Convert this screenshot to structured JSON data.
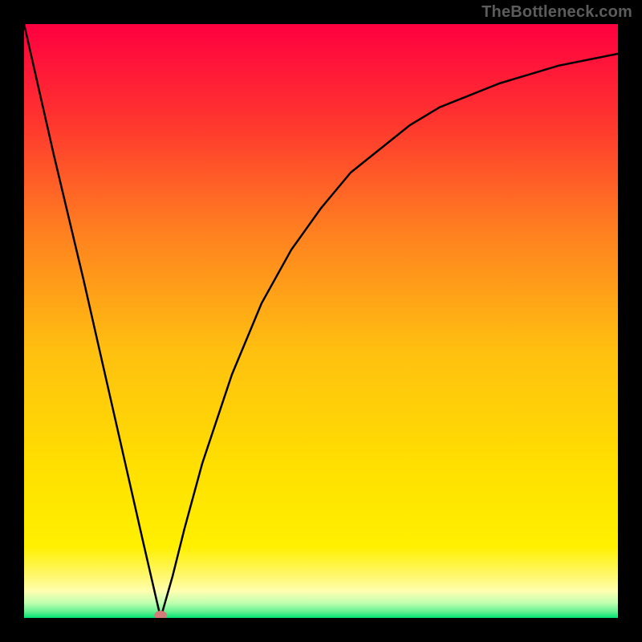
{
  "attribution": "TheBottleneck.com",
  "chart_data": {
    "type": "line",
    "title": "",
    "xlabel": "",
    "ylabel": "",
    "xlim": [
      0,
      100
    ],
    "ylim": [
      0,
      100
    ],
    "grid": false,
    "legend": false,
    "series": [
      {
        "name": "bottleneck",
        "x": [
          0,
          5,
          10,
          15,
          20,
          23,
          25,
          27,
          30,
          35,
          40,
          45,
          50,
          55,
          60,
          65,
          70,
          75,
          80,
          85,
          90,
          95,
          100
        ],
        "values": [
          100,
          78,
          57,
          35,
          13,
          0,
          7,
          15,
          26,
          41,
          53,
          62,
          69,
          75,
          79,
          83,
          86,
          88,
          90,
          91.5,
          93,
          94,
          95
        ]
      }
    ],
    "minimum_point": {
      "x": 23,
      "y": 0
    },
    "gradient_stops": [
      {
        "offset": 0.0,
        "color": "#ff0040"
      },
      {
        "offset": 0.15,
        "color": "#ff3030"
      },
      {
        "offset": 0.35,
        "color": "#ff8020"
      },
      {
        "offset": 0.55,
        "color": "#ffc010"
      },
      {
        "offset": 0.75,
        "color": "#ffe000"
      },
      {
        "offset": 0.88,
        "color": "#fff000"
      },
      {
        "offset": 0.93,
        "color": "#fff870"
      },
      {
        "offset": 0.955,
        "color": "#ffffb0"
      },
      {
        "offset": 0.975,
        "color": "#c0ffb0"
      },
      {
        "offset": 0.99,
        "color": "#60f090"
      },
      {
        "offset": 1.0,
        "color": "#00e070"
      }
    ],
    "marker": {
      "color": "#d47a7a",
      "rx": 8,
      "ry": 6
    }
  }
}
